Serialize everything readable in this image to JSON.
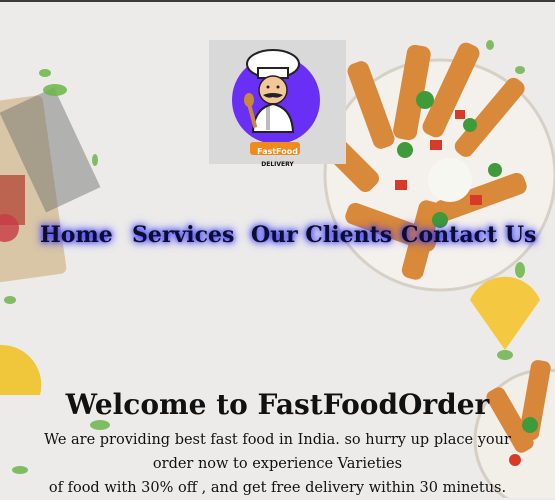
{
  "logo": {
    "text_line1": "FastFood",
    "text_line2": "DELIVERY",
    "accent": "#6a2ff5",
    "badge": "#f08a1c"
  },
  "nav": {
    "items": [
      {
        "label": "Home"
      },
      {
        "label": "Services"
      },
      {
        "label": "Our Clients"
      },
      {
        "label": "Contact Us"
      }
    ]
  },
  "hero": {
    "title": "Welcome to FastFoodOrder",
    "line1": "We are providing best fast food in India. so hurry up place your",
    "line2": "order now to experience Varieties",
    "line3": "of food with 30% off , and get free delivery within 30 minetus."
  }
}
